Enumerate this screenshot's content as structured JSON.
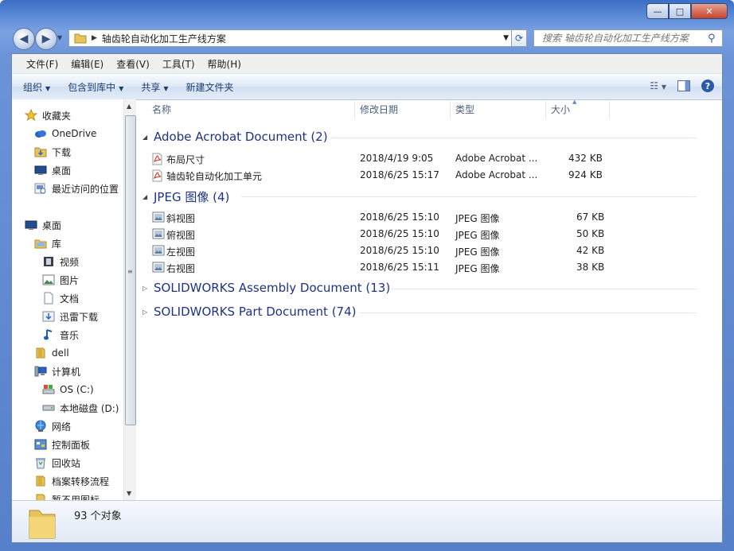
{
  "window": {
    "caption_buttons": {
      "minimize": "—",
      "maximize": "□",
      "close": "✕"
    }
  },
  "navbar": {
    "path": "轴齿轮自动化加工生产线方案",
    "search_placeholder": "搜索 轴齿轮自动化加工生产线方案"
  },
  "menu": [
    "文件(F)",
    "编辑(E)",
    "查看(V)",
    "工具(T)",
    "帮助(H)"
  ],
  "commands": [
    "组织",
    "包含到库中",
    "共享",
    "新建文件夹"
  ],
  "sidebar": {
    "items": [
      {
        "label": "收藏夹",
        "icon": "star-icon"
      },
      {
        "label": "OneDrive",
        "icon": "cloud-icon"
      },
      {
        "label": "下载",
        "icon": "folder-icon"
      },
      {
        "label": "桌面",
        "icon": "desktop-icon"
      },
      {
        "label": "最近访问的位置",
        "icon": "recent-icon"
      },
      {
        "label": "桌面",
        "icon": "desktop-icon"
      },
      {
        "label": "库",
        "icon": "library-icon"
      },
      {
        "label": "视频",
        "icon": "video-icon"
      },
      {
        "label": "图片",
        "icon": "picture-icon"
      },
      {
        "label": "文档",
        "icon": "document-icon"
      },
      {
        "label": "迅雷下载",
        "icon": "download-icon"
      },
      {
        "label": "音乐",
        "icon": "music-icon"
      },
      {
        "label": "dell",
        "icon": "user-folder-icon"
      },
      {
        "label": "计算机",
        "icon": "computer-icon"
      },
      {
        "label": "OS (C:)",
        "icon": "drive-icon"
      },
      {
        "label": "本地磁盘 (D:)",
        "icon": "drive-icon"
      },
      {
        "label": "网络",
        "icon": "network-icon"
      },
      {
        "label": "控制面板",
        "icon": "control-panel-icon"
      },
      {
        "label": "回收站",
        "icon": "recycle-bin-icon"
      },
      {
        "label": "档案转移流程",
        "icon": "folder-icon"
      },
      {
        "label": "暂不用图标",
        "icon": "folder-icon"
      }
    ]
  },
  "columns": {
    "name": "名称",
    "date": "修改日期",
    "type": "类型",
    "size": "大小"
  },
  "groups": [
    {
      "title": "Adobe Acrobat Document (2)",
      "expanded": true,
      "files": [
        {
          "name": "布局尺寸",
          "date": "2018/4/19 9:05",
          "type": "Adobe Acrobat ...",
          "size": "432 KB",
          "icon": "pdf-icon"
        },
        {
          "name": "轴齿轮自动化加工单元",
          "date": "2018/6/25 15:17",
          "type": "Adobe Acrobat ...",
          "size": "924 KB",
          "icon": "pdf-icon"
        }
      ]
    },
    {
      "title": "JPEG 图像 (4)",
      "expanded": true,
      "files": [
        {
          "name": "斜视图",
          "date": "2018/6/25 15:10",
          "type": "JPEG 图像",
          "size": "67 KB",
          "icon": "image-icon"
        },
        {
          "name": "俯视图",
          "date": "2018/6/25 15:10",
          "type": "JPEG 图像",
          "size": "50 KB",
          "icon": "image-icon"
        },
        {
          "name": "左视图",
          "date": "2018/6/25 15:10",
          "type": "JPEG 图像",
          "size": "42 KB",
          "icon": "image-icon"
        },
        {
          "name": "右视图",
          "date": "2018/6/25 15:11",
          "type": "JPEG 图像",
          "size": "38 KB",
          "icon": "image-icon"
        }
      ]
    },
    {
      "title": "SOLIDWORKS Assembly Document (13)",
      "expanded": false,
      "files": []
    },
    {
      "title": "SOLIDWORKS Part Document (74)",
      "expanded": false,
      "files": []
    }
  ],
  "status": {
    "count": "93 个对象"
  }
}
